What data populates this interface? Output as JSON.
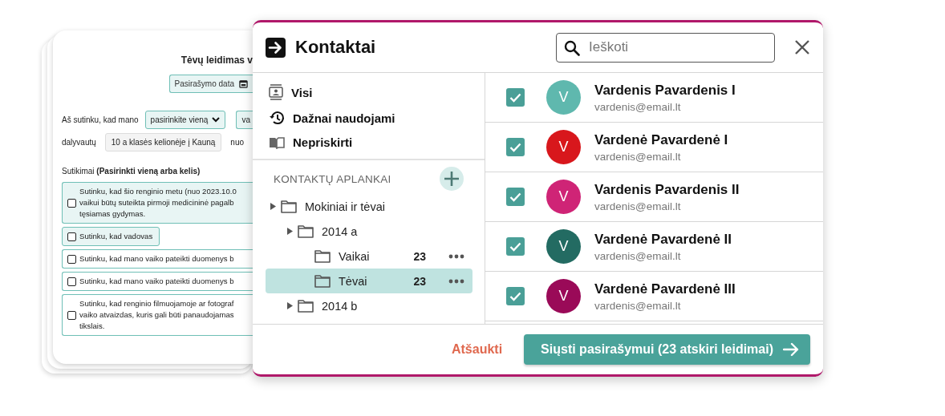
{
  "document": {
    "title": "Tėvų leidimas v",
    "date_field": {
      "placeholder": "Pasirašymo data"
    },
    "line_1": {
      "label": "Aš sutinku, kad mano",
      "dropdown": "pasirinkite vieną",
      "field_cut": "va"
    },
    "line_2": {
      "label": "dalyvautų",
      "field": "10 a klasės kelionėje į Kauną",
      "label_2": "nuo"
    },
    "consents_heading": "Sutikimai **(Pasirinkti vieną arba kelis)**",
    "consents": [
      {
        "text": "Sutinku, kad šio renginio metu (nuo 2023.10.0\nvaikui būtų suteikta pirmoji medicininė pagalb\ntęsiamas gydymas.",
        "checked": false,
        "selected": true
      },
      {
        "text": "Sutinku, kad vadovas",
        "checked": false,
        "selected": true
      },
      {
        "text": "Sutinku, kad mano vaiko pateikti duomenys b",
        "checked": false,
        "selected": false
      },
      {
        "text": "Sutinku, kad mano vaiko pateikti duomenys b",
        "checked": false,
        "selected": false
      },
      {
        "text": "Sutinku, kad renginio filmuojamoje ar fotograf\nvaiko atvaizdas, kuris gali būti panaudojamas\ntikslais.",
        "checked": false,
        "selected": false
      }
    ]
  },
  "dialog": {
    "title": "Kontaktai",
    "search": {
      "placeholder": "Ieškoti"
    },
    "nav": [
      {
        "label": "Visi"
      },
      {
        "label": "Dažnai naudojami"
      },
      {
        "label": "Nepriskirti"
      }
    ],
    "folders_heading": "KONTAKTŲ APLANKAI",
    "folders": [
      {
        "label": "Mokiniai ir tėvai",
        "selected": false,
        "children": [
          {
            "label": "2014 a",
            "selected": false,
            "children": [
              {
                "label": "Vaikai",
                "count": "23",
                "selected": false
              },
              {
                "label": "Tėvai",
                "count": "23",
                "selected": true
              }
            ]
          },
          {
            "label": "2014 b",
            "selected": false
          }
        ]
      }
    ],
    "contacts": [
      {
        "name": "Vardenis Pavardenis I",
        "email": "vardenis@email.lt",
        "initial": "V",
        "color": "#5fb8ae",
        "checked": true
      },
      {
        "name": "Vardenė Pavardenė I",
        "email": "vardenis@email.lt",
        "initial": "V",
        "color": "#d8171c",
        "checked": true
      },
      {
        "name": "Vardenis Pavardenis II",
        "email": "vardenis@email.lt",
        "initial": "V",
        "color": "#cf2476",
        "checked": true
      },
      {
        "name": "Vardenė Pavardenė II",
        "email": "vardenis@email.lt",
        "initial": "V",
        "color": "#236b62",
        "checked": true
      },
      {
        "name": "Vardenė Pavardenė III",
        "email": "vardenis@email.lt",
        "initial": "V",
        "color": "#9a0a58",
        "checked": true
      }
    ],
    "cancel": "Atšaukti",
    "submit": "Siųsti pasirašymui (23 atskiri leidimai)"
  }
}
